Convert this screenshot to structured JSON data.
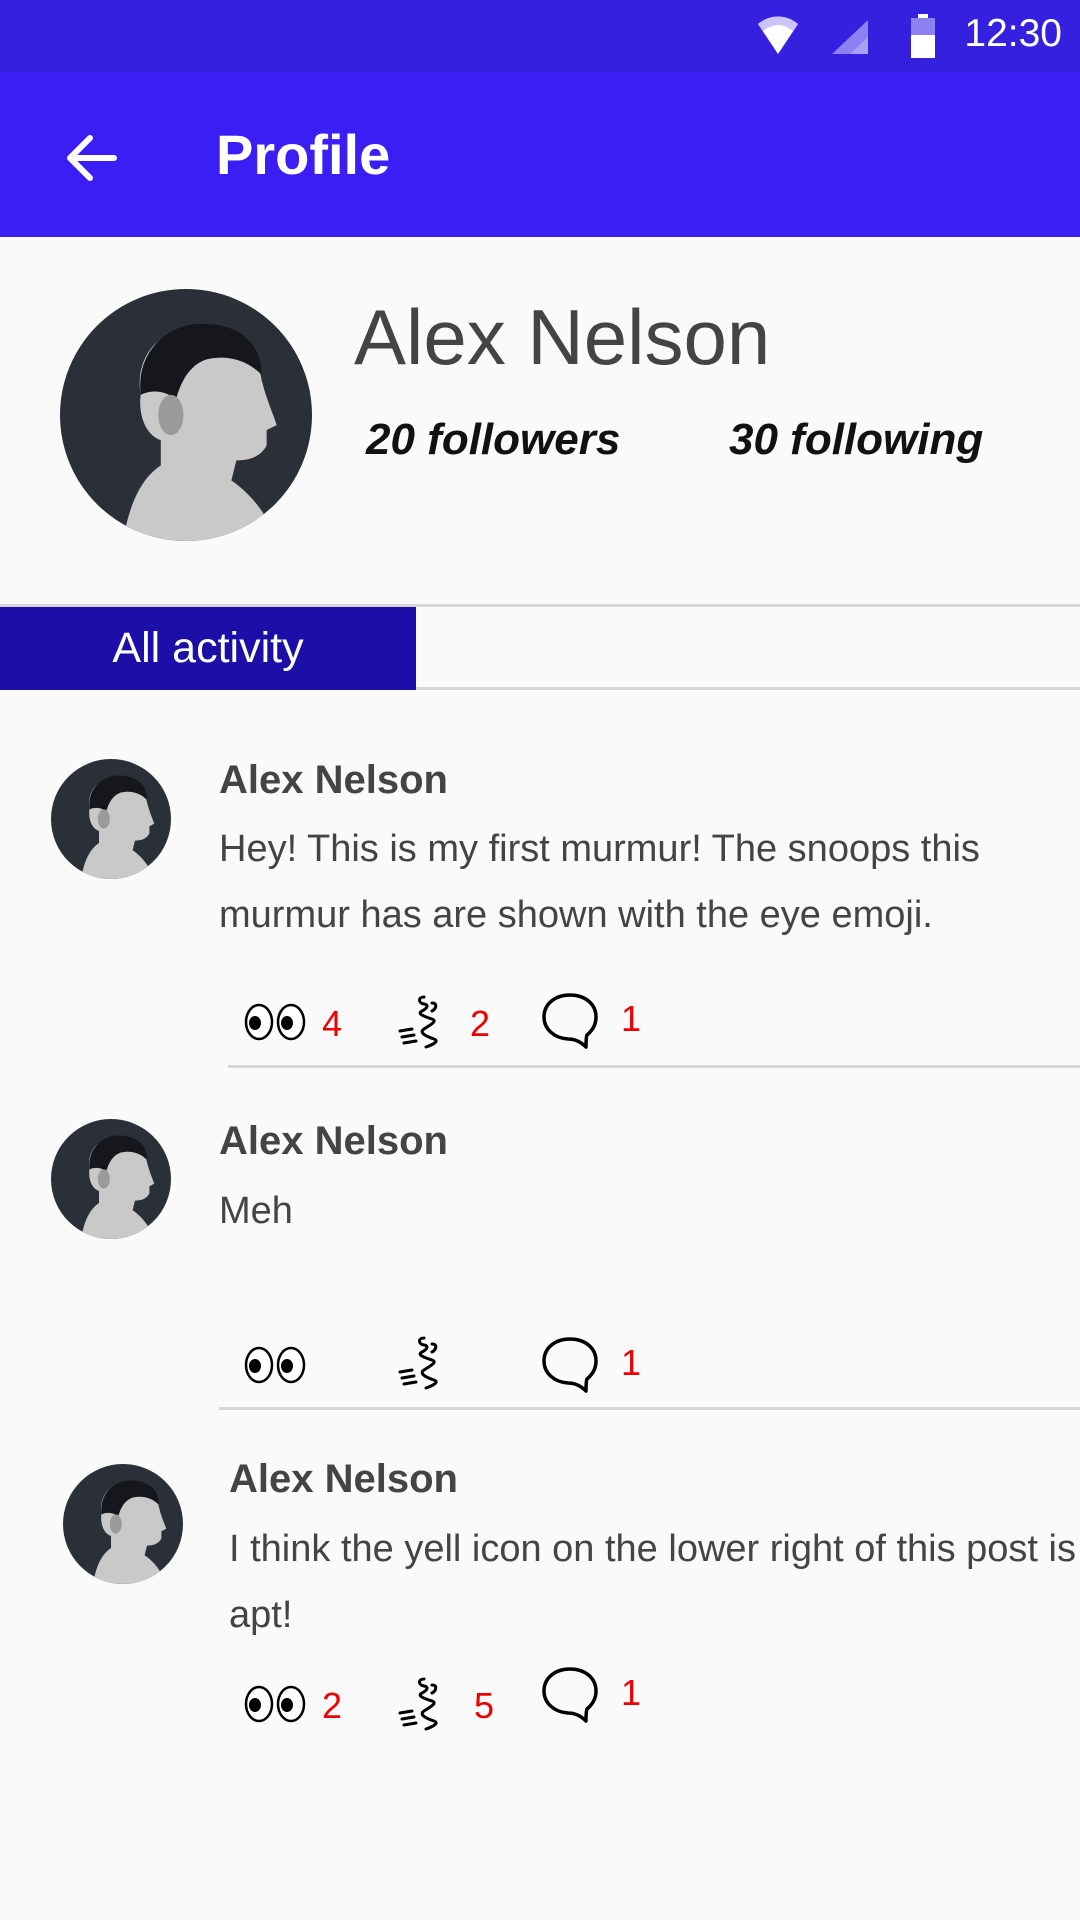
{
  "status_bar": {
    "time": "12:30"
  },
  "app_bar": {
    "title": "Profile"
  },
  "profile": {
    "name": "Alex Nelson",
    "followers": "20 followers",
    "following": "30 following"
  },
  "tabs": [
    {
      "label": "All activity"
    }
  ],
  "posts": [
    {
      "author": "Alex Nelson",
      "text": "Hey! This is my first murmur! The snoops this murmur has are shown with the eye emoji.",
      "snoops": "4",
      "yells": "2",
      "comments": "1"
    },
    {
      "author": "Alex Nelson",
      "text": "Meh",
      "snoops": "",
      "yells": "",
      "comments": "1"
    },
    {
      "author": "Alex Nelson",
      "text": "I think the yell icon on the lower right of this post is apt!",
      "snoops": "2",
      "yells": "5",
      "comments": "1"
    }
  ],
  "icons": {
    "back": "arrow-left-icon",
    "wifi": "wifi-icon",
    "signal": "signal-icon",
    "battery": "battery-icon",
    "snoop": "eyes-icon",
    "yell": "yell-icon",
    "comment": "speech-bubble-icon"
  },
  "colors": {
    "status_bar": "#3620e0",
    "app_bar": "#3a1ef4",
    "active_tab": "#1c0fa8",
    "count": "#ee0000"
  }
}
